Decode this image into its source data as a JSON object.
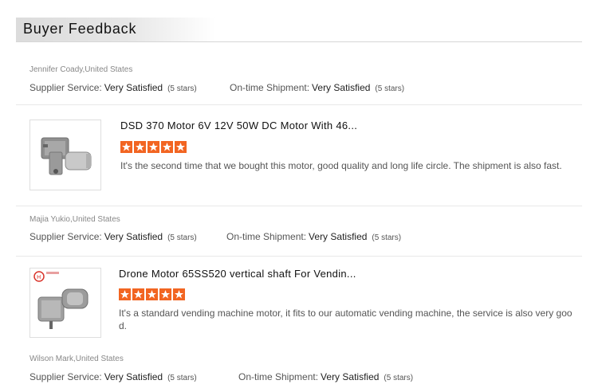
{
  "header": {
    "title": "Buyer Feedback"
  },
  "reviews": [
    {
      "reviewer": "Jennifer Coady,United States",
      "supplier_label": "Supplier Service:",
      "supplier_value": "Very Satisfied",
      "supplier_stars": "(5 stars)",
      "shipment_label": "On-time Shipment:",
      "shipment_value": "Very Satisfied",
      "shipment_stars": "(5 stars)",
      "product_title": "DSD 370 Motor 6V 12V 50W DC Motor With 46...",
      "rating": 5,
      "comment": "It's the second time that we bought this motor, good quality and long life circle. The shipment is also fast."
    },
    {
      "reviewer": "Majia Yukio,United States",
      "supplier_label": "Supplier Service:",
      "supplier_value": "Very Satisfied",
      "supplier_stars": "(5 stars)",
      "shipment_label": "On-time Shipment:",
      "shipment_value": "Very Satisfied",
      "shipment_stars": "(5 stars)",
      "product_title": "Drone Motor 65SS520 vertical shaft For Vendin...",
      "rating": 5,
      "comment": "It's a standard vending machine motor, it fits to our automatic vending machine, the service is also very goo d."
    },
    {
      "reviewer": "Wilson Mark,United States",
      "supplier_label": "Supplier Service:",
      "supplier_value": "Very Satisfied",
      "supplier_stars": "(5 stars)",
      "shipment_label": "On-time Shipment:",
      "shipment_value": "Very Satisfied",
      "shipment_stars": "(5 stars)"
    }
  ],
  "colors": {
    "star": "#f26522",
    "divider": "#e8e8e8"
  }
}
